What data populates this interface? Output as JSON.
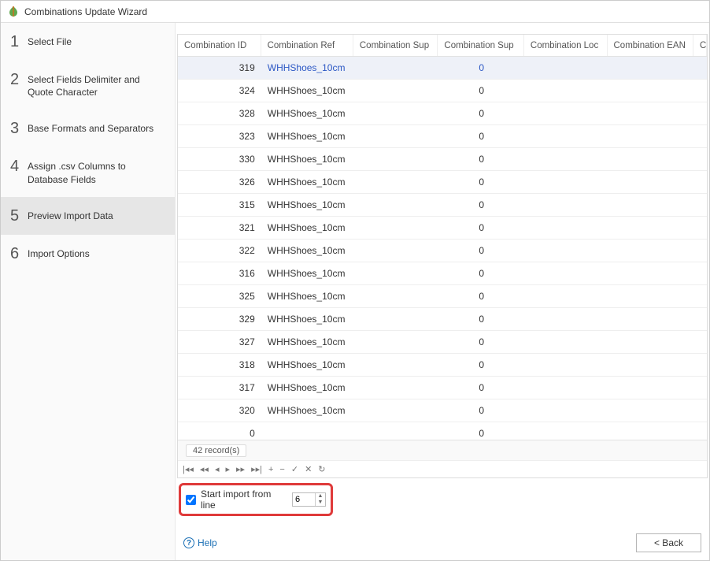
{
  "window": {
    "title": "Combinations Update Wizard"
  },
  "sidebar": {
    "steps": [
      {
        "num": "1",
        "label": "Select File"
      },
      {
        "num": "2",
        "label": "Select Fields Delimiter and Quote Character"
      },
      {
        "num": "3",
        "label": "Base Formats and Separators"
      },
      {
        "num": "4",
        "label": "Assign .csv Columns to Database Fields"
      },
      {
        "num": "5",
        "label": "Preview Import Data"
      },
      {
        "num": "6",
        "label": "Import Options"
      }
    ],
    "activeIndex": 4
  },
  "table": {
    "columns": [
      "Combination ID",
      "Combination Ref",
      "Combination Sup",
      "Combination Sup",
      "Combination Loc",
      "Combination EAN",
      "Combinati"
    ],
    "rows": [
      {
        "id": "319",
        "ref": "WHHShoes_10cm",
        "sup2": "0",
        "selected": true
      },
      {
        "id": "324",
        "ref": "WHHShoes_10cm",
        "sup2": "0"
      },
      {
        "id": "328",
        "ref": "WHHShoes_10cm",
        "sup2": "0"
      },
      {
        "id": "323",
        "ref": "WHHShoes_10cm",
        "sup2": "0"
      },
      {
        "id": "330",
        "ref": "WHHShoes_10cm",
        "sup2": "0"
      },
      {
        "id": "326",
        "ref": "WHHShoes_10cm",
        "sup2": "0"
      },
      {
        "id": "315",
        "ref": "WHHShoes_10cm",
        "sup2": "0"
      },
      {
        "id": "321",
        "ref": "WHHShoes_10cm",
        "sup2": "0"
      },
      {
        "id": "322",
        "ref": "WHHShoes_10cm",
        "sup2": "0"
      },
      {
        "id": "316",
        "ref": "WHHShoes_10cm",
        "sup2": "0"
      },
      {
        "id": "325",
        "ref": "WHHShoes_10cm",
        "sup2": "0"
      },
      {
        "id": "329",
        "ref": "WHHShoes_10cm",
        "sup2": "0"
      },
      {
        "id": "327",
        "ref": "WHHShoes_10cm",
        "sup2": "0"
      },
      {
        "id": "318",
        "ref": "WHHShoes_10cm",
        "sup2": "0"
      },
      {
        "id": "317",
        "ref": "WHHShoes_10cm",
        "sup2": "0"
      },
      {
        "id": "320",
        "ref": "WHHShoes_10cm",
        "sup2": "0"
      },
      {
        "id": "0",
        "ref": "",
        "sup2": "0"
      }
    ],
    "status": "42 record(s)"
  },
  "startImport": {
    "label": "Start import from line",
    "value": "6",
    "checked": true
  },
  "footer": {
    "help": "Help",
    "back": "< Back"
  },
  "nav": {
    "first": "|◂◂",
    "prevpage": "◂◂",
    "prev": "◂",
    "next": "▸",
    "nextpage": "▸▸",
    "last": "▸▸|",
    "add": "+",
    "del": "−",
    "ok": "✓",
    "cancel": "✕",
    "refresh": "↻"
  }
}
